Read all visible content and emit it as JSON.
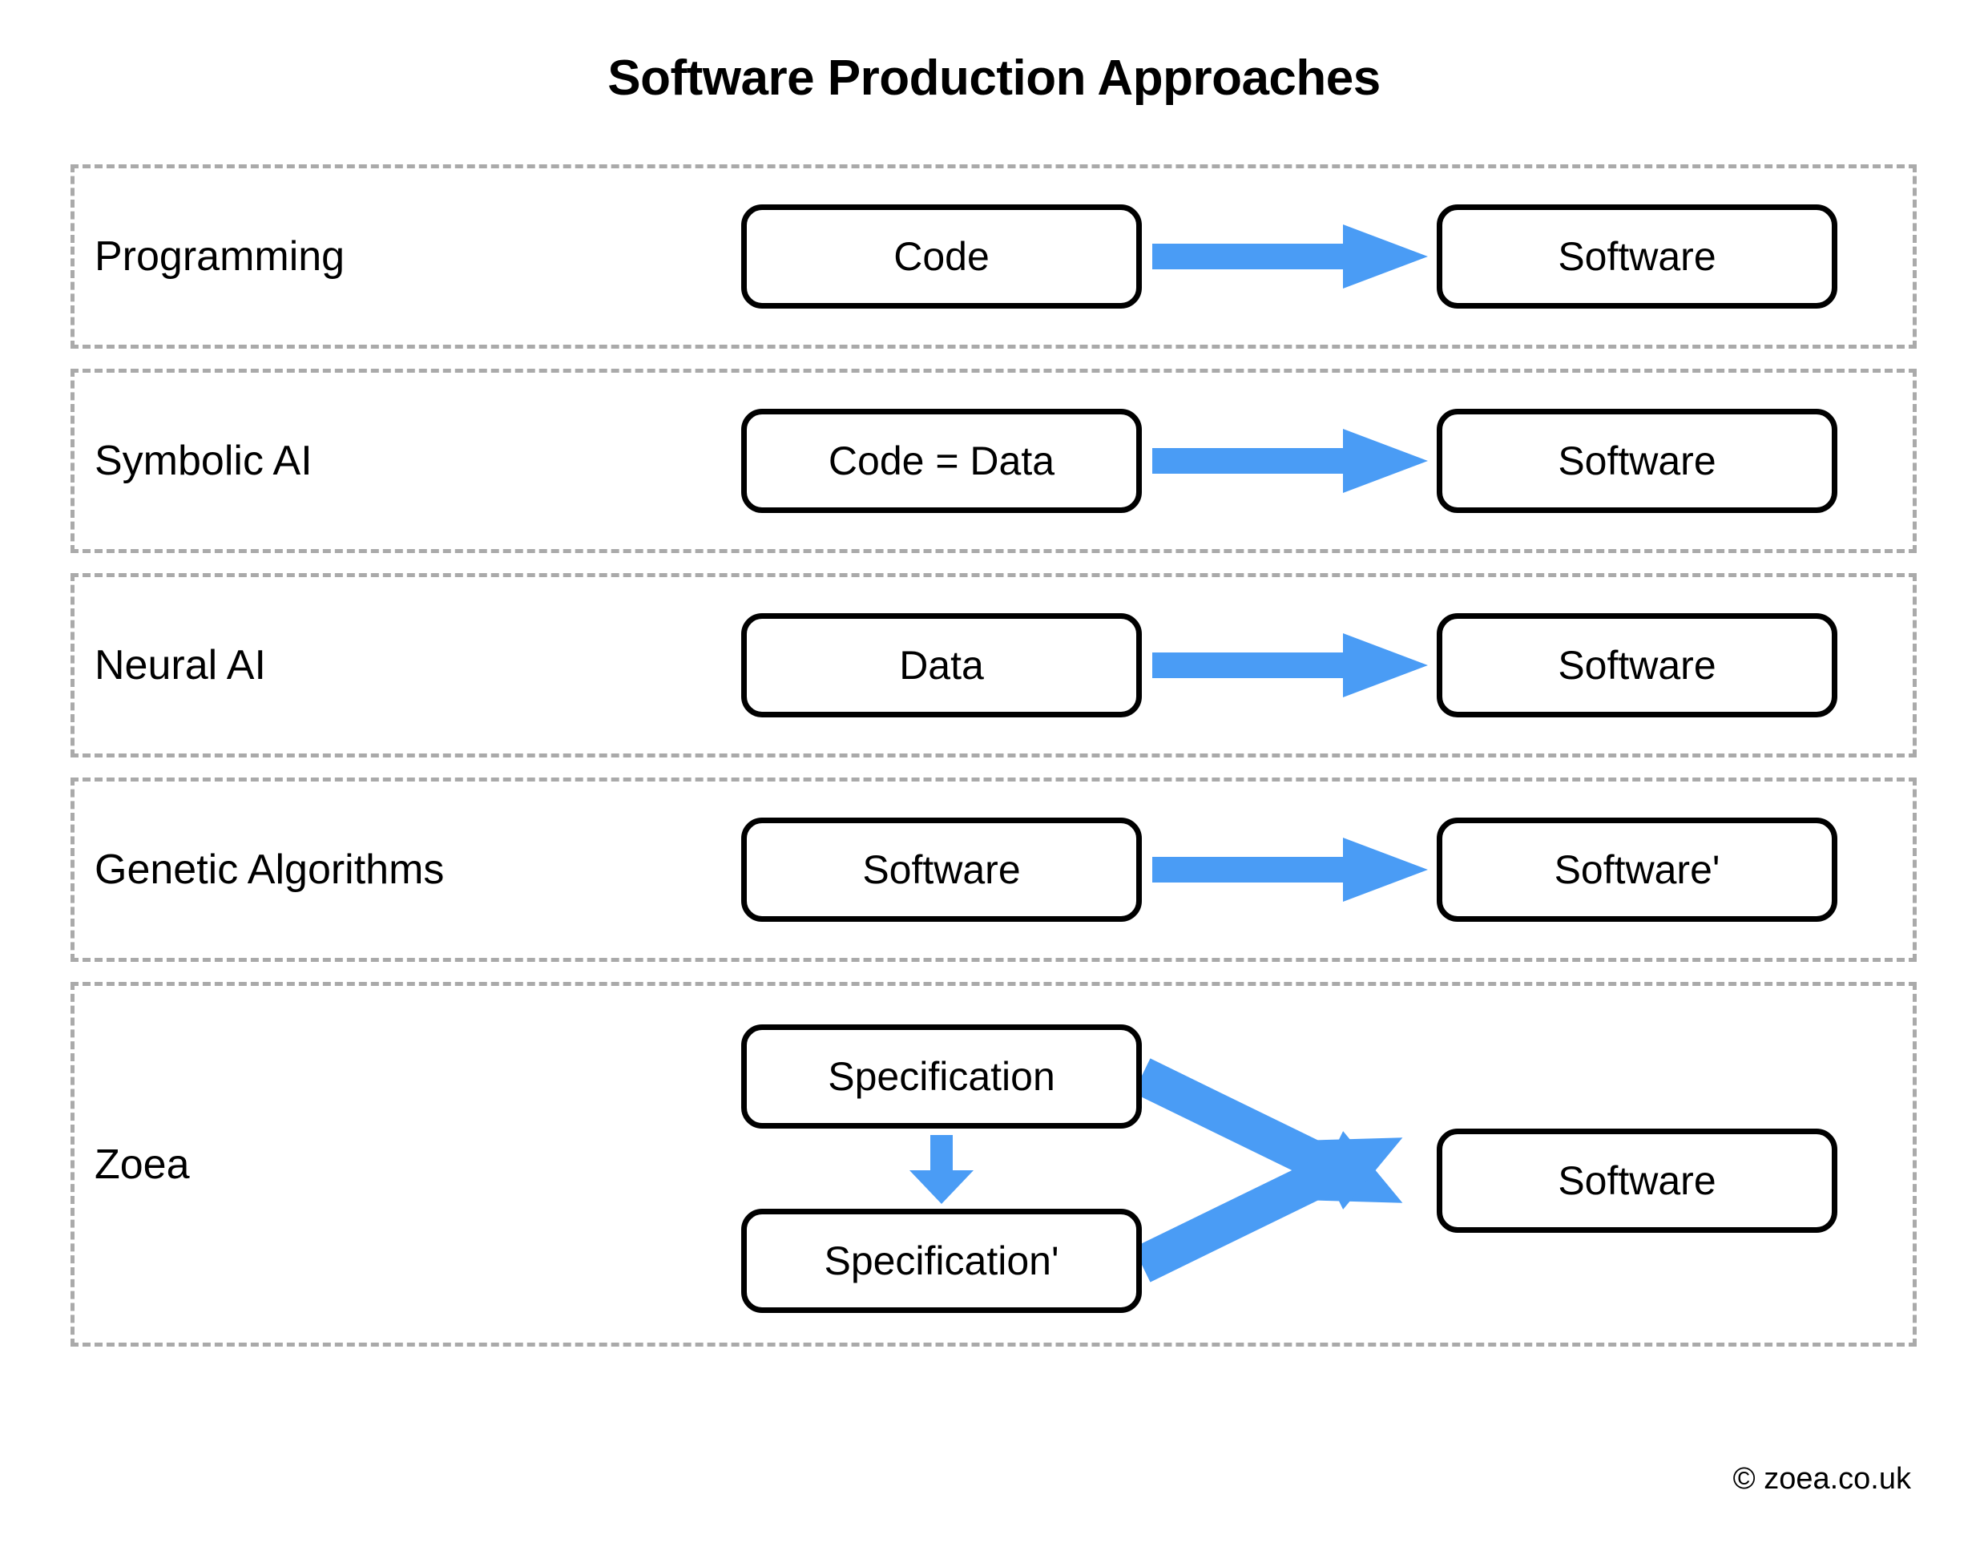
{
  "title": "Software Production Approaches",
  "accent_color": "#4a9cf5",
  "border_color": "#000000",
  "dashed_border_color": "#aaaaaa",
  "footer": "© zoea.co.uk",
  "rows": [
    {
      "label": "Programming",
      "source": "Code",
      "target": "Software",
      "arrow": "right-block-arrow"
    },
    {
      "label": "Symbolic AI",
      "source": "Code = Data",
      "target": "Software",
      "arrow": "right-block-arrow"
    },
    {
      "label": "Neural AI",
      "source": "Data",
      "target": "Software",
      "arrow": "right-block-arrow"
    },
    {
      "label": "Genetic Algorithms",
      "source": "Software",
      "target": "Software'",
      "arrow": "right-block-arrow"
    },
    {
      "label": "Zoea",
      "source": "Specification",
      "source2": "Specification'",
      "target": "Software",
      "arrow": "down-block-arrow",
      "arrow_upper": "diagonal-down-right-arrow",
      "arrow_lower": "diagonal-up-right-arrow"
    }
  ]
}
